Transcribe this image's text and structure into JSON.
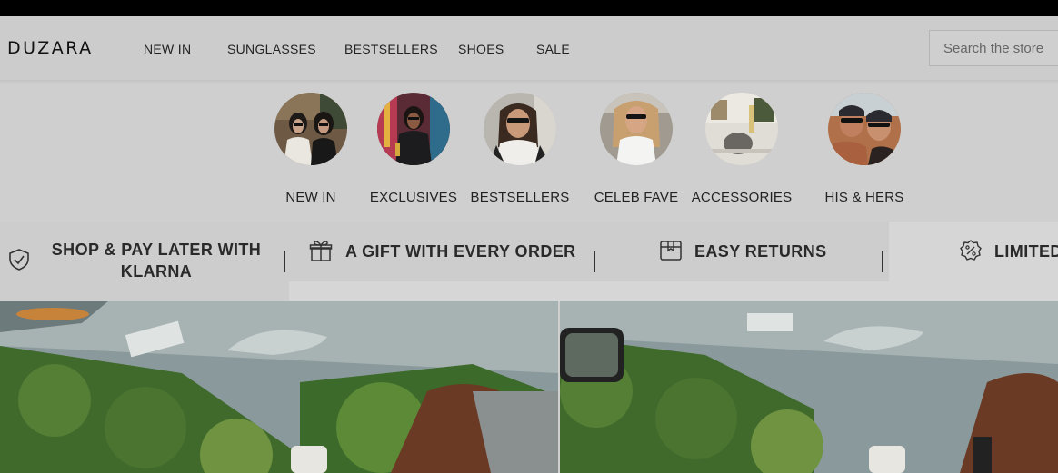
{
  "brand": {
    "logo_text": "DUZARA"
  },
  "nav": {
    "items": [
      {
        "label": "NEW IN"
      },
      {
        "label": "SUNGLASSES"
      },
      {
        "label": "BESTSELLERS"
      },
      {
        "label": "SHOES"
      },
      {
        "label": "SALE"
      }
    ]
  },
  "search": {
    "placeholder": "Search the store"
  },
  "categories": [
    {
      "label": "NEW IN"
    },
    {
      "label": "EXCLUSIVES"
    },
    {
      "label": "BESTSELLERS"
    },
    {
      "label": "CELEB FAVE"
    },
    {
      "label": "ACCESSORIES"
    },
    {
      "label": "HIS & HERS"
    }
  ],
  "usps": [
    {
      "line1": "SHOP & PAY LATER WITH",
      "line2": "KLARNA",
      "icon": "shield-check-icon"
    },
    {
      "line1": "A GIFT WITH EVERY ORDER",
      "icon": "gift-icon"
    },
    {
      "line1": "EASY RETURNS",
      "icon": "box-icon"
    },
    {
      "line1": "LIMITED",
      "icon": "discount-badge-icon"
    }
  ]
}
